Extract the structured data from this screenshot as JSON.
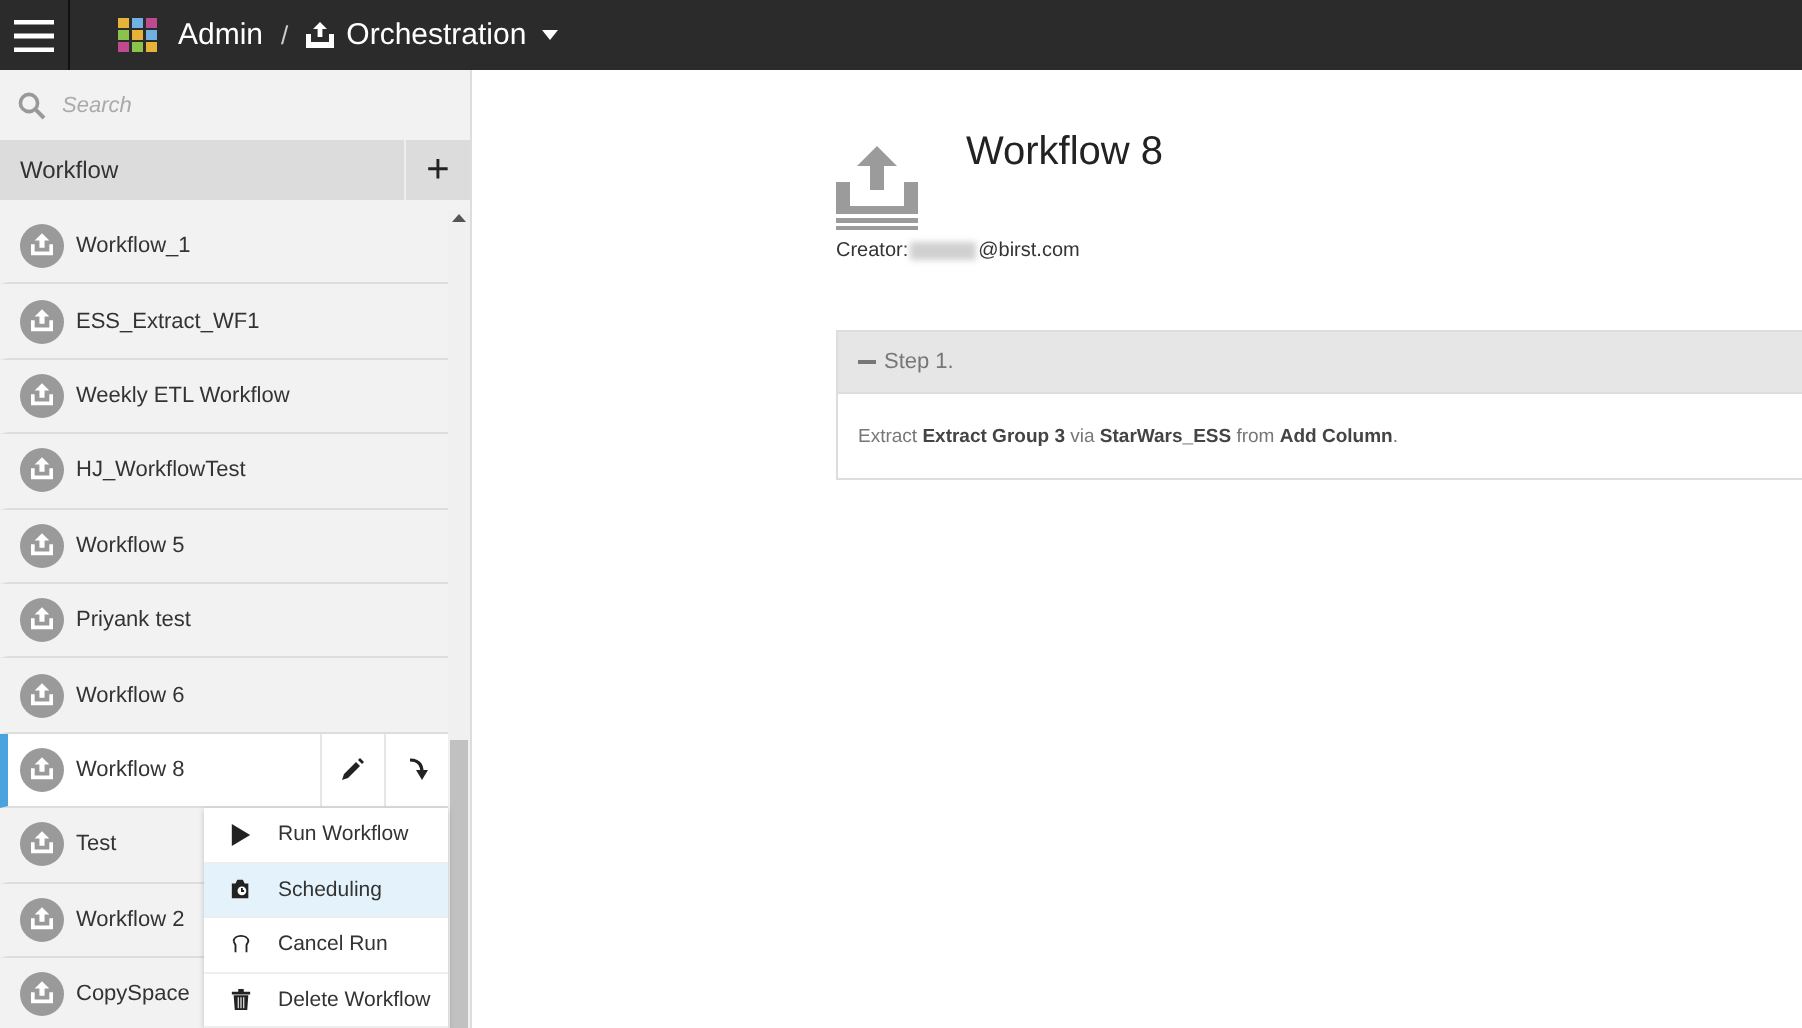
{
  "top_bar": {
    "breadcrumb": [
      "Admin",
      "Orchestration"
    ],
    "separator": "/"
  },
  "sidebar": {
    "search": {
      "placeholder": "Search"
    },
    "header": {
      "title": "Workflow",
      "add_button": "+"
    },
    "items": [
      {
        "label": "Workflow_1",
        "selected": false
      },
      {
        "label": "ESS_Extract_WF1",
        "selected": false
      },
      {
        "label": "Weekly ETL Workflow",
        "selected": false
      },
      {
        "label": "HJ_WorkflowTest",
        "selected": false
      },
      {
        "label": "Workflow 5",
        "selected": false
      },
      {
        "label": "Priyank test",
        "selected": false
      },
      {
        "label": "Workflow 6",
        "selected": false
      },
      {
        "label": "Workflow 8",
        "selected": true
      },
      {
        "label": "Test",
        "selected": false
      },
      {
        "label": "Workflow 2",
        "selected": false
      },
      {
        "label": "CopySpace",
        "selected": false
      }
    ],
    "context_menu": [
      {
        "label": "Run Workflow",
        "kind": "run",
        "selected": false
      },
      {
        "label": "Scheduling",
        "kind": "schedule",
        "selected": true
      },
      {
        "label": "Cancel Run",
        "kind": "cancel",
        "selected": false
      },
      {
        "label": "Delete Workflow",
        "kind": "delete",
        "selected": false
      }
    ]
  },
  "main": {
    "title": "Workflow 8",
    "creator_label": "Creator:",
    "creator_value": "@birst.com",
    "steps": [
      {
        "title": "Step 1.",
        "expanded": true,
        "text": "Extract **Extract Group 3** via **StarWars_ESS** from **Add Column**."
      }
    ]
  }
}
